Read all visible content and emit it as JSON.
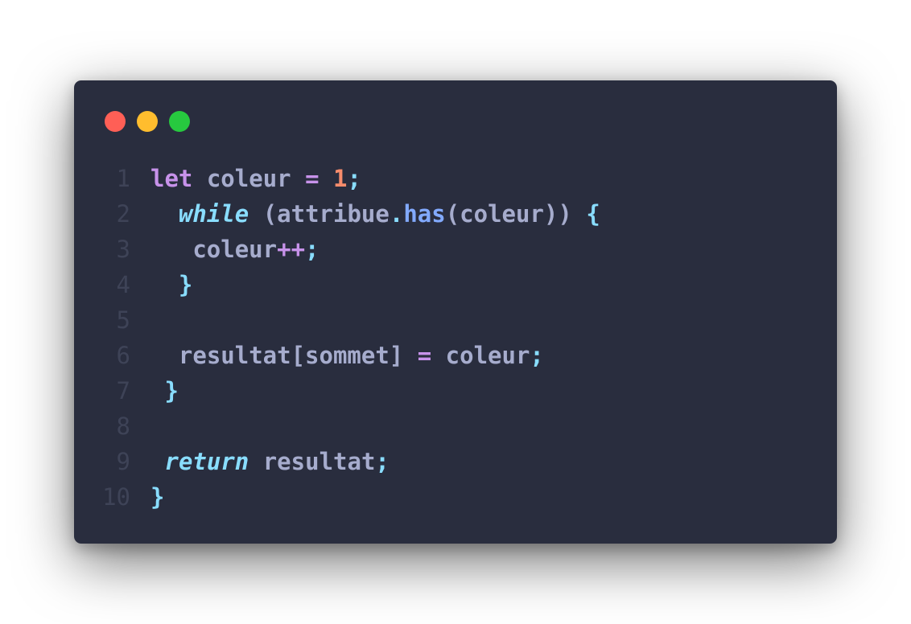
{
  "window": {
    "background": "#292d3e",
    "controls": [
      {
        "name": "close",
        "color": "#ff5f56"
      },
      {
        "name": "minimize",
        "color": "#ffbd2e"
      },
      {
        "name": "maximize",
        "color": "#27c93f"
      }
    ]
  },
  "code": {
    "language": "javascript",
    "lines": [
      {
        "number": "1",
        "tokens": [
          {
            "text": "let",
            "kind": "keyword"
          },
          {
            "text": " coleur ",
            "kind": "identifier"
          },
          {
            "text": "=",
            "kind": "operator"
          },
          {
            "text": " ",
            "kind": "identifier"
          },
          {
            "text": "1",
            "kind": "number"
          },
          {
            "text": ";",
            "kind": "punctuation"
          }
        ]
      },
      {
        "number": "2",
        "tokens": [
          {
            "text": "  ",
            "kind": "identifier"
          },
          {
            "text": "while",
            "kind": "control"
          },
          {
            "text": " (attribue",
            "kind": "identifier"
          },
          {
            "text": ".",
            "kind": "punctuation"
          },
          {
            "text": "has",
            "kind": "function"
          },
          {
            "text": "(coleur)) ",
            "kind": "identifier"
          },
          {
            "text": "{",
            "kind": "punctuation"
          }
        ]
      },
      {
        "number": "3",
        "tokens": [
          {
            "text": "    coleur",
            "kind": "identifier"
          },
          {
            "text": "++",
            "kind": "operator"
          },
          {
            "text": ";",
            "kind": "punctuation"
          }
        ]
      },
      {
        "number": "4",
        "tokens": [
          {
            "text": "  ",
            "kind": "identifier"
          },
          {
            "text": "}",
            "kind": "punctuation"
          }
        ]
      },
      {
        "number": "5",
        "tokens": []
      },
      {
        "number": "6",
        "tokens": [
          {
            "text": "  resultat[sommet] ",
            "kind": "identifier"
          },
          {
            "text": "=",
            "kind": "operator"
          },
          {
            "text": " coleur",
            "kind": "identifier"
          },
          {
            "text": ";",
            "kind": "punctuation"
          }
        ]
      },
      {
        "number": "7",
        "tokens": [
          {
            "text": "}",
            "kind": "punctuation"
          }
        ]
      },
      {
        "number": "8",
        "tokens": []
      },
      {
        "number": "9",
        "tokens": [
          {
            "text": "return",
            "kind": "control"
          },
          {
            "text": " resultat",
            "kind": "identifier"
          },
          {
            "text": ";",
            "kind": "punctuation"
          }
        ]
      },
      {
        "number": "10",
        "tokens": [
          {
            "text": "}",
            "kind": "punctuation"
          }
        ]
      }
    ]
  }
}
